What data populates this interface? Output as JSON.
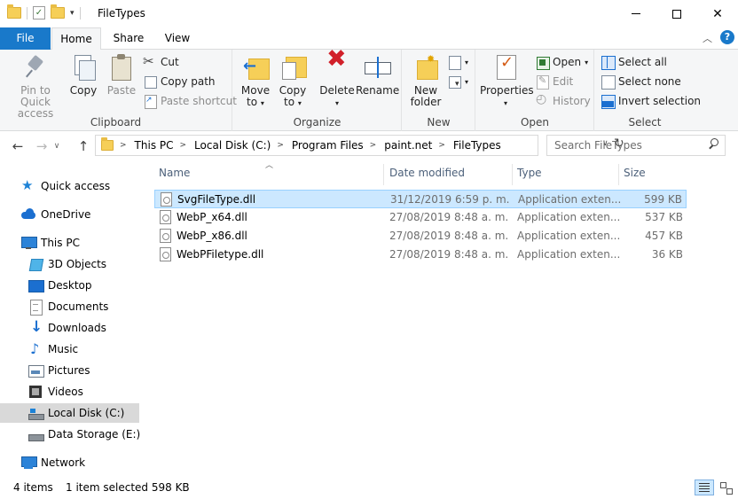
{
  "window": {
    "title": "FileTypes"
  },
  "ribbon_tabs": {
    "file": "File",
    "home": "Home",
    "share": "Share",
    "view": "View"
  },
  "ribbon": {
    "clipboard": {
      "label": "Clipboard",
      "pin_line1": "Pin to Quick",
      "pin_line2": "access",
      "copy": "Copy",
      "paste": "Paste",
      "cut": "Cut",
      "copy_path": "Copy path",
      "paste_shortcut": "Paste shortcut"
    },
    "organize": {
      "label": "Organize",
      "move_to_line1": "Move",
      "move_to_line2": "to",
      "copy_to_line1": "Copy",
      "copy_to_line2": "to",
      "delete": "Delete",
      "rename": "Rename"
    },
    "new": {
      "label": "New",
      "new_folder_line1": "New",
      "new_folder_line2": "folder"
    },
    "open": {
      "label": "Open",
      "properties": "Properties",
      "open": "Open",
      "edit": "Edit",
      "history": "History"
    },
    "select": {
      "label": "Select",
      "select_all": "Select all",
      "select_none": "Select none",
      "invert_selection": "Invert selection"
    }
  },
  "address": {
    "crumbs": [
      "This PC",
      "Local Disk (C:)",
      "Program Files",
      "paint.net",
      "FileTypes"
    ],
    "search_placeholder": "Search FileTypes"
  },
  "nav": {
    "quick_access": "Quick access",
    "onedrive": "OneDrive",
    "this_pc": "This PC",
    "objects3d": "3D Objects",
    "desktop": "Desktop",
    "documents": "Documents",
    "downloads": "Downloads",
    "music": "Music",
    "pictures": "Pictures",
    "videos": "Videos",
    "local_disk": "Local Disk (C:)",
    "data_storage": "Data Storage (E:)",
    "network": "Network"
  },
  "columns": {
    "name": "Name",
    "date": "Date modified",
    "type": "Type",
    "size": "Size"
  },
  "files": [
    {
      "name": "SvgFileType.dll",
      "date": "31/12/2019 6:59 p. m.",
      "type": "Application exten...",
      "size": "599 KB",
      "selected": true
    },
    {
      "name": "WebP_x64.dll",
      "date": "27/08/2019 8:48 a. m.",
      "type": "Application exten...",
      "size": "537 KB",
      "selected": false
    },
    {
      "name": "WebP_x86.dll",
      "date": "27/08/2019 8:48 a. m.",
      "type": "Application exten...",
      "size": "457 KB",
      "selected": false
    },
    {
      "name": "WebPFiletype.dll",
      "date": "27/08/2019 8:48 a. m.",
      "type": "Application exten...",
      "size": "36 KB",
      "selected": false
    }
  ],
  "status": {
    "count": "4 items",
    "selected": "1 item selected  598 KB"
  },
  "colors": {
    "accent": "#1979ca",
    "selection": "#cce8ff"
  }
}
